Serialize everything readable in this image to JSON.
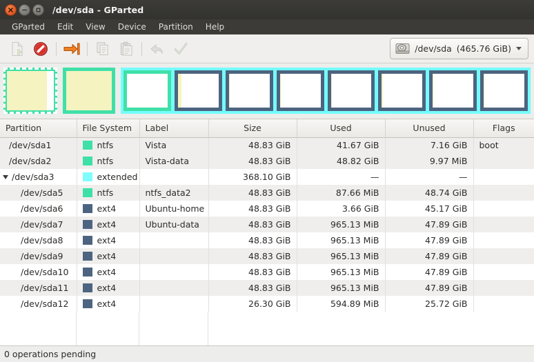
{
  "window": {
    "title": "/dev/sda - GParted",
    "buttons": [
      {
        "name": "close",
        "glyph": "x"
      },
      {
        "name": "minimize",
        "glyph": "-"
      },
      {
        "name": "maximize",
        "glyph": "square"
      }
    ]
  },
  "menu": {
    "items": [
      {
        "label": "GParted"
      },
      {
        "label": "Edit"
      },
      {
        "label": "View"
      },
      {
        "label": "Device"
      },
      {
        "label": "Partition"
      },
      {
        "label": "Help"
      }
    ]
  },
  "toolbar": {
    "buttons": [
      {
        "name": "new-partition",
        "icon": "new-document-icon",
        "enabled": false
      },
      {
        "name": "delete-partition",
        "icon": "delete-prohibition-icon",
        "enabled": true
      },
      {
        "name": "resize-move-partition",
        "icon": "resize-move-arrow-icon",
        "enabled": true
      },
      {
        "name": "copy-partition",
        "icon": "copy-icon",
        "enabled": false
      },
      {
        "name": "paste-partition",
        "icon": "paste-icon",
        "enabled": false
      },
      {
        "name": "undo-operation",
        "icon": "undo-arrow-icon",
        "enabled": false
      },
      {
        "name": "apply-operations",
        "icon": "apply-checkmark-icon",
        "enabled": false
      }
    ],
    "device_selector": {
      "icon": "hard-disk-icon",
      "device": "/dev/sda",
      "size": "(465.76 GiB)"
    }
  },
  "graphic": {
    "blocks": [
      {
        "name": "sda1",
        "border_color": "#3fe0a7",
        "used_pct": 85,
        "width_pct": 10.4,
        "selected": true,
        "nested": false
      },
      {
        "name": "sda2",
        "border_color": "#3fe0a7",
        "used_pct": 100,
        "width_pct": 10.4,
        "selected": false,
        "nested": false
      },
      {
        "name": "sda5",
        "border_color": "#3fe0a7",
        "used_pct": 0,
        "width_pct": 100,
        "selected": false,
        "nested": true
      },
      {
        "name": "sda6",
        "border_color": "#4c6480",
        "used_pct": 8,
        "width_pct": 100,
        "selected": false,
        "nested": true
      },
      {
        "name": "sda7",
        "border_color": "#4c6480",
        "used_pct": 2,
        "width_pct": 100,
        "selected": false,
        "nested": true
      },
      {
        "name": "sda8",
        "border_color": "#4c6480",
        "used_pct": 2,
        "width_pct": 100,
        "selected": false,
        "nested": true
      },
      {
        "name": "sda9",
        "border_color": "#4c6480",
        "used_pct": 2,
        "width_pct": 100,
        "selected": false,
        "nested": true
      },
      {
        "name": "sda10",
        "border_color": "#4c6480",
        "used_pct": 2,
        "width_pct": 100,
        "selected": false,
        "nested": true
      },
      {
        "name": "sda11",
        "border_color": "#4c6480",
        "used_pct": 2,
        "width_pct": 100,
        "selected": false,
        "nested": true
      },
      {
        "name": "sda12",
        "border_color": "#4c6480",
        "used_pct": 2,
        "width_pct": 100,
        "selected": false,
        "nested": true
      }
    ],
    "extended_color": "#74fcfc",
    "used_color": "#f5f3c0",
    "unused_color": "#ffffff"
  },
  "table": {
    "headers": [
      "Partition",
      "File System",
      "Label",
      "Size",
      "Used",
      "Unused",
      "Flags"
    ],
    "rows": [
      {
        "partition": "/dev/sda1",
        "fs": "ntfs",
        "fs_color": "#3fe0a7",
        "label": "Vista",
        "size": "48.83 GiB",
        "used": "41.67 GiB",
        "unused": "7.16 GiB",
        "flags": "boot",
        "indent": 0,
        "expander": false,
        "shaded": true
      },
      {
        "partition": "/dev/sda2",
        "fs": "ntfs",
        "fs_color": "#3fe0a7",
        "label": "Vista-data",
        "size": "48.83 GiB",
        "used": "48.82 GiB",
        "unused": "9.97 MiB",
        "flags": "",
        "indent": 0,
        "expander": false,
        "shaded": true
      },
      {
        "partition": "/dev/sda3",
        "fs": "extended",
        "fs_color": "#7ffdfd",
        "label": "",
        "size": "368.10 GiB",
        "used": "—",
        "unused": "—",
        "flags": "",
        "indent": 0,
        "expander": true,
        "shaded": false
      },
      {
        "partition": "/dev/sda5",
        "fs": "ntfs",
        "fs_color": "#3fe0a7",
        "label": "ntfs_data2",
        "size": "48.83 GiB",
        "used": "87.66 MiB",
        "unused": "48.74 GiB",
        "flags": "",
        "indent": 1,
        "expander": false,
        "shaded": true
      },
      {
        "partition": "/dev/sda6",
        "fs": "ext4",
        "fs_color": "#4c6480",
        "label": "Ubuntu-home",
        "size": "48.83 GiB",
        "used": "3.66 GiB",
        "unused": "45.17 GiB",
        "flags": "",
        "indent": 1,
        "expander": false,
        "shaded": false
      },
      {
        "partition": "/dev/sda7",
        "fs": "ext4",
        "fs_color": "#4c6480",
        "label": "Ubuntu-data",
        "size": "48.83 GiB",
        "used": "965.13 MiB",
        "unused": "47.89 GiB",
        "flags": "",
        "indent": 1,
        "expander": false,
        "shaded": true
      },
      {
        "partition": "/dev/sda8",
        "fs": "ext4",
        "fs_color": "#4c6480",
        "label": "",
        "size": "48.83 GiB",
        "used": "965.13 MiB",
        "unused": "47.89 GiB",
        "flags": "",
        "indent": 1,
        "expander": false,
        "shaded": false
      },
      {
        "partition": "/dev/sda9",
        "fs": "ext4",
        "fs_color": "#4c6480",
        "label": "",
        "size": "48.83 GiB",
        "used": "965.13 MiB",
        "unused": "47.89 GiB",
        "flags": "",
        "indent": 1,
        "expander": false,
        "shaded": true
      },
      {
        "partition": "/dev/sda10",
        "fs": "ext4",
        "fs_color": "#4c6480",
        "label": "",
        "size": "48.83 GiB",
        "used": "965.13 MiB",
        "unused": "47.89 GiB",
        "flags": "",
        "indent": 1,
        "expander": false,
        "shaded": false
      },
      {
        "partition": "/dev/sda11",
        "fs": "ext4",
        "fs_color": "#4c6480",
        "label": "",
        "size": "48.83 GiB",
        "used": "965.13 MiB",
        "unused": "47.89 GiB",
        "flags": "",
        "indent": 1,
        "expander": false,
        "shaded": true
      },
      {
        "partition": "/dev/sda12",
        "fs": "ext4",
        "fs_color": "#4c6480",
        "label": "",
        "size": "26.30 GiB",
        "used": "594.89 MiB",
        "unused": "25.72 GiB",
        "flags": "",
        "indent": 1,
        "expander": false,
        "shaded": false
      }
    ]
  },
  "statusbar": {
    "text": "0 operations pending"
  }
}
